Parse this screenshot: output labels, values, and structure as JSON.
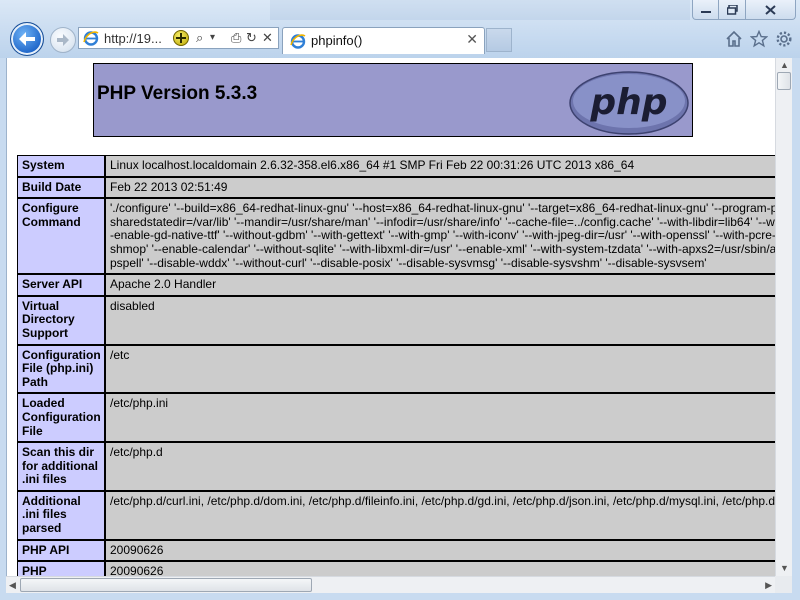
{
  "browser": {
    "address_url": "http://19...",
    "tab_title": "phpinfo()",
    "tab_close": "✕",
    "address_tools": [
      "⌕",
      "▾",
      "⎙",
      "↻",
      "✕"
    ]
  },
  "page": {
    "version_title": "PHP Version 5.3.3",
    "logo_text": "php",
    "rows": [
      {
        "key": "System",
        "value": "Linux localhost.localdomain 2.6.32-358.el6.x86_64 #1 SMP Fri Feb 22 00:31:26 UTC 2013 x86_64"
      },
      {
        "key": "Build Date",
        "value": "Feb 22 2013 02:51:49"
      },
      {
        "key": "Configure Command",
        "value": "'./configure' '--build=x86_64-redhat-linux-gnu' '--host=x86_64-redhat-linux-gnu' '--target=x86_64-redhat-linux-gnu' '--program-pr\nsharedstatedir=/var/lib' '--mandir=/usr/share/man' '--infodir=/usr/share/info' '--cache-file=../config.cache' '--with-libdir=lib64' '--wit\n-enable-gd-native-ttf' '--without-gdbm' '--with-gettext' '--with-gmp' '--with-iconv' '--with-jpeg-dir=/usr' '--with-openssl' '--with-pcre-r\nshmop' '--enable-calendar' '--without-sqlite' '--with-libxml-dir=/usr' '--enable-xml' '--with-system-tzdata' '--with-apxs2=/usr/sbin/ap\npspell' '--disable-wddx' '--without-curl' '--disable-posix' '--disable-sysvmsg' '--disable-sysvshm' '--disable-sysvsem'"
      },
      {
        "key": "Server API",
        "value": "Apache 2.0 Handler"
      },
      {
        "key": "Virtual Directory Support",
        "value": "disabled"
      },
      {
        "key": "Configuration File (php.ini) Path",
        "value": "/etc"
      },
      {
        "key": "Loaded Configuration File",
        "value": "/etc/php.ini"
      },
      {
        "key": "Scan this dir for additional .ini files",
        "value": "/etc/php.d"
      },
      {
        "key": "Additional .ini files parsed",
        "value": "/etc/php.d/curl.ini, /etc/php.d/dom.ini, /etc/php.d/fileinfo.ini, /etc/php.d/gd.ini, /etc/php.d/json.ini, /etc/php.d/mysql.ini, /etc/php.d/"
      },
      {
        "key": "PHP API",
        "value": "20090626"
      },
      {
        "key": "PHP",
        "value": "20090626"
      }
    ]
  },
  "colors": {
    "header_bg": "#9999cc",
    "key_cell_bg": "#ccccff",
    "value_cell_bg": "#cccccc",
    "browser_chrome": "#c8dbf0"
  }
}
